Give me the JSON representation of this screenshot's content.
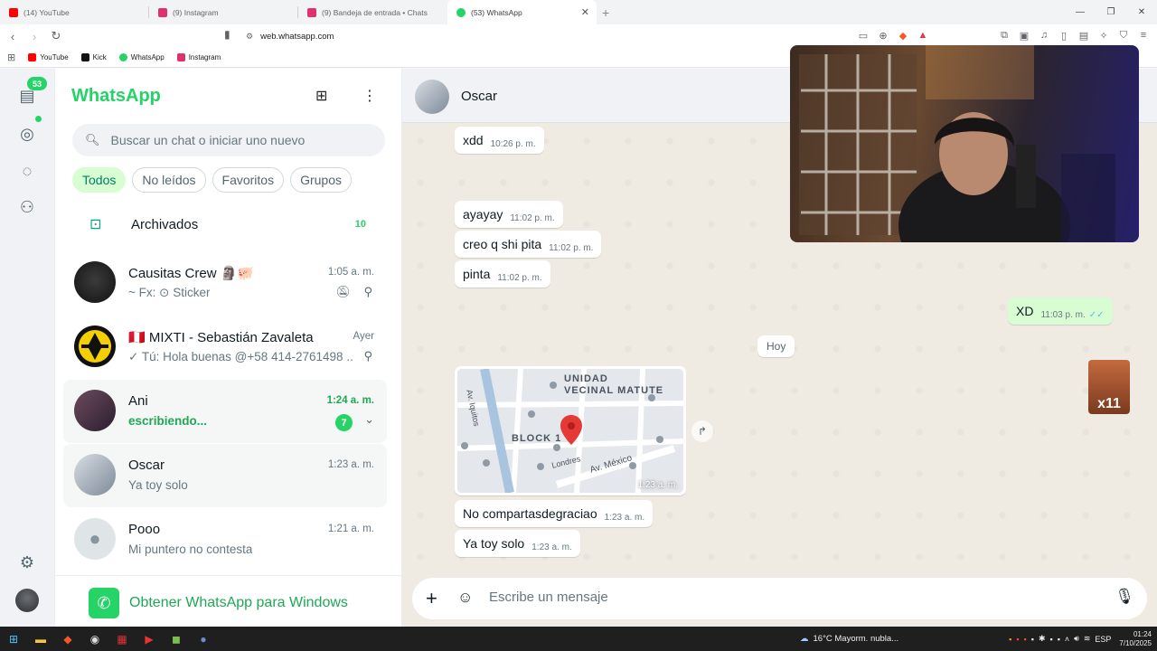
{
  "browser": {
    "tabs": [
      {
        "title": "(14) YouTube",
        "color": "#ff0000"
      },
      {
        "title": "(9) Instagram",
        "color": "#e1306c"
      },
      {
        "title": "(9) Bandeja de entrada • Chats",
        "color": "#e1306c"
      },
      {
        "title": "(53) WhatsApp",
        "color": "#25d366",
        "active": true
      }
    ],
    "url": "web.whatsapp.com",
    "bookmarks": [
      {
        "label": "YouTube",
        "color": "#ff0000"
      },
      {
        "label": "Kick",
        "color": "#111111"
      },
      {
        "label": "WhatsApp",
        "color": "#25d366"
      },
      {
        "label": "Instagram",
        "color": "#e1306c"
      }
    ]
  },
  "rail": {
    "chats_badge": "53"
  },
  "sidebar": {
    "brand": "WhatsApp",
    "search_placeholder": "Buscar un chat o iniciar uno nuevo",
    "filters": [
      "Todos",
      "No leídos",
      "Favoritos",
      "Grupos"
    ],
    "archived": {
      "label": "Archivados",
      "count": "10"
    },
    "chats": [
      {
        "name": "Causitas Crew 🗿🐖",
        "time": "1:05 a. m.",
        "preview": "~ Fx: ⊙ Sticker"
      },
      {
        "name": "🇵🇪 MIXTI - Sebastián Zavaleta",
        "time": "Ayer",
        "preview": "✓ Tú: Hola buenas @+58 414-2761498 ..."
      },
      {
        "name": "Ani",
        "time": "1:24 a. m.",
        "preview": "escribiendo...",
        "unread": "7"
      },
      {
        "name": "Oscar",
        "time": "1:23 a. m.",
        "preview": "Ya toy solo"
      },
      {
        "name": "Pooo",
        "time": "1:21 a. m.",
        "preview": "Mi puntero no contesta"
      }
    ],
    "get_windows": "Obtener WhatsApp para Windows"
  },
  "conversation": {
    "contact": "Oscar",
    "day_label": "Hoy",
    "messages": [
      {
        "text": "xdd",
        "time": "10:26 p. m."
      },
      {
        "text": "ayayay",
        "time": "11:02 p. m."
      },
      {
        "text": "creo q shi pita",
        "time": "11:02 p. m."
      },
      {
        "text": "pinta",
        "time": "11:02 p. m."
      },
      {
        "text": "XD",
        "time": "11:03 p. m."
      },
      {
        "text": "No compartasdegraciao",
        "time": "1:23 a. m."
      },
      {
        "text": "Ya toy solo",
        "time": "1:23 a. m."
      }
    ],
    "map": {
      "labels": [
        "UNIDAD",
        "VECINAL MATUTE",
        "BLOCK 1",
        "Av. Iquitos",
        "Londres",
        "Av. México"
      ],
      "time": "1:23 a. m."
    },
    "sticker_text": "x11",
    "composer_placeholder": "Escribe un mensaje"
  },
  "taskbar": {
    "weather": "16°C  Mayorm. nubla...",
    "lang": "ESP",
    "time": "01:24",
    "date": "7/10/2025"
  },
  "colors": {
    "accent": "#25d366",
    "bubble_out": "#d9fdd3",
    "chat_bg": "#efeae2"
  }
}
